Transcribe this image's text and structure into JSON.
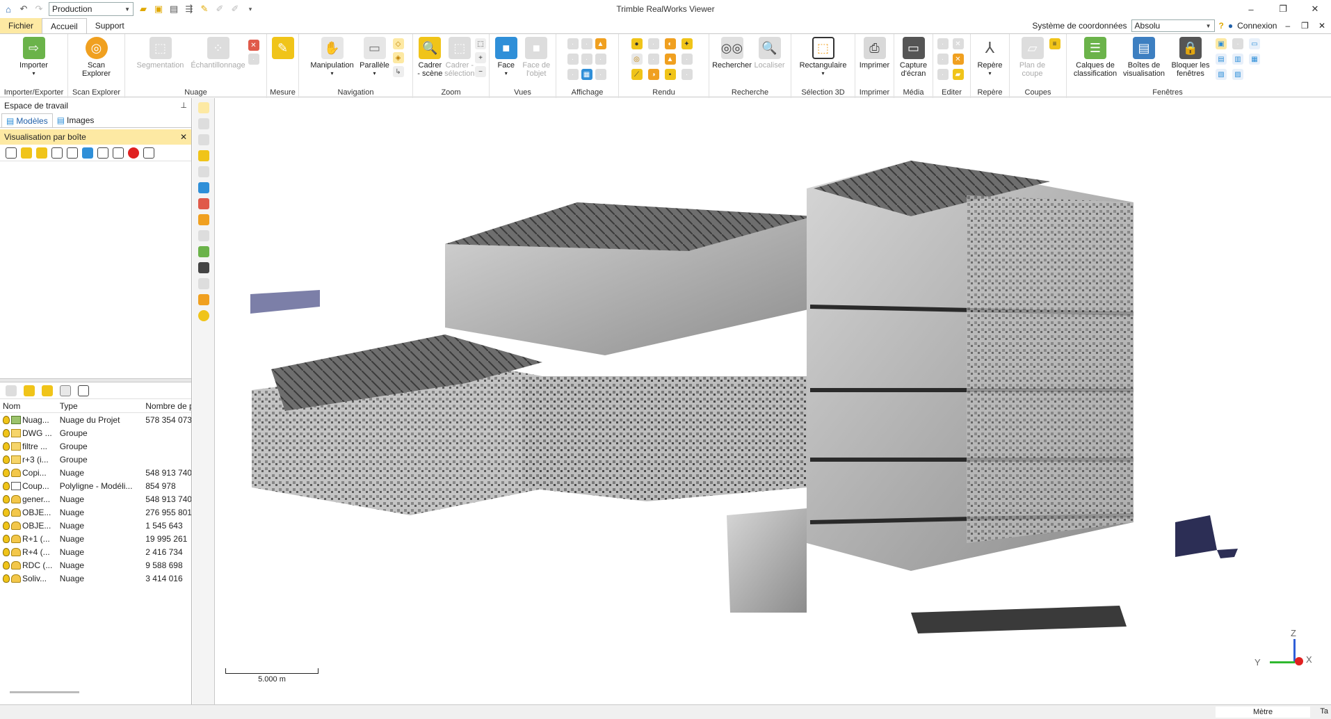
{
  "window": {
    "title": "Trimble RealWorks Viewer"
  },
  "quick_access": {
    "project_combo": "Production"
  },
  "tabs": [
    {
      "label": "Fichier"
    },
    {
      "label": "Accueil"
    },
    {
      "label": "Support"
    }
  ],
  "coords": {
    "label": "Système de coordonnées",
    "value": "Absolu",
    "connexion": "Connexion"
  },
  "ribbon": {
    "importer": {
      "label": "Importer",
      "group": "Importer/Exporter"
    },
    "scan": {
      "label1": "Scan",
      "label2": "Explorer",
      "group": "Scan Explorer"
    },
    "nuage": {
      "seg": "Segmentation",
      "ech": "Échantillonnage",
      "group": "Nuage"
    },
    "mesure": {
      "group": "Mesure"
    },
    "navigation": {
      "manip": "Manipulation",
      "para": "Parallèle",
      "group": "Navigation"
    },
    "zoom": {
      "c1a": "Cadrer",
      "c1b": "- scène",
      "c2a": "Cadrer -",
      "c2b": "sélection",
      "group": "Zoom"
    },
    "vues": {
      "face": "Face",
      "fo1": "Face de",
      "fo2": "l'objet",
      "group": "Vues"
    },
    "affichage": {
      "group": "Affichage"
    },
    "rendu": {
      "group": "Rendu"
    },
    "recherche": {
      "rech": "Rechercher",
      "loc": "Localiser",
      "group": "Recherche"
    },
    "selection3d": {
      "rect": "Rectangulaire",
      "group": "Sélection 3D"
    },
    "imprimer": {
      "label": "Imprimer",
      "group": "Imprimer"
    },
    "media": {
      "cap1": "Capture",
      "cap2": "d'écran",
      "group": "Média"
    },
    "editer": {
      "group": "Editer"
    },
    "repere": {
      "label": "Repère",
      "group": "Repère"
    },
    "coupes": {
      "p1": "Plan de",
      "p2": "coupe",
      "group": "Coupes"
    },
    "fenetres": {
      "cal1": "Calques de",
      "cal2": "classification",
      "boi1": "Boîtes de",
      "boi2": "visualisation",
      "blo1": "Bloquer les",
      "blo2": "fenêtres",
      "group": "Fenêtres"
    }
  },
  "workspace": {
    "title": "Espace de travail",
    "tab_models": "Modèles",
    "tab_images": "Images",
    "visbox": "Visualisation par boîte"
  },
  "tree": {
    "headers": [
      "Nom",
      "Type",
      "Nombre de p"
    ],
    "rows": [
      {
        "name": "Nuag...",
        "type": "Nuage du Projet",
        "count": "578 354 073",
        "icon": "project"
      },
      {
        "name": "DWG ...",
        "type": "Groupe",
        "count": "",
        "icon": "folder"
      },
      {
        "name": "filtre ...",
        "type": "Groupe",
        "count": "",
        "icon": "folder"
      },
      {
        "name": "r+3 (i...",
        "type": "Groupe",
        "count": "",
        "icon": "folder"
      },
      {
        "name": "Copi...",
        "type": "Nuage",
        "count": "548 913 740",
        "icon": "cloud"
      },
      {
        "name": "Coup...",
        "type": "Polyligne - Modéli...",
        "count": "854 978",
        "icon": "poly"
      },
      {
        "name": "gener...",
        "type": "Nuage",
        "count": "548 913 740",
        "icon": "cloud"
      },
      {
        "name": "OBJE...",
        "type": "Nuage",
        "count": "276 955 801",
        "icon": "cloud"
      },
      {
        "name": "OBJE...",
        "type": "Nuage",
        "count": "1 545 643",
        "icon": "cloud"
      },
      {
        "name": "R+1 (...",
        "type": "Nuage",
        "count": "19 995 261",
        "icon": "cloud"
      },
      {
        "name": "R+4 (...",
        "type": "Nuage",
        "count": "2 416 734",
        "icon": "cloud"
      },
      {
        "name": "RDC (...",
        "type": "Nuage",
        "count": "9 588 698",
        "icon": "cloud"
      },
      {
        "name": "Soliv...",
        "type": "Nuage",
        "count": "3 414 016",
        "icon": "cloud"
      }
    ]
  },
  "viewport": {
    "scale_label": "5.000 m",
    "axis_z": "Z",
    "axis_y": "Y",
    "axis_x": "X"
  },
  "status": {
    "unit": "Mètre",
    "right": "Ta"
  },
  "colors": {
    "file_tab": "#fde9a3",
    "accent": "#1f5fa8",
    "icon_blue": "#2f8fd8",
    "icon_orange": "#f0a020"
  }
}
